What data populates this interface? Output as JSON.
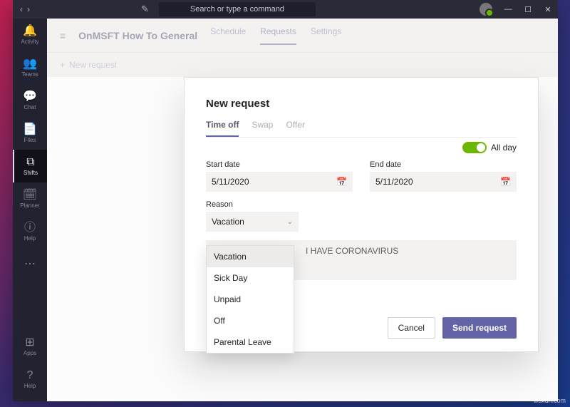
{
  "titlebar": {
    "search_placeholder": "Search or type a command",
    "min": "—",
    "max": "☐",
    "close": "✕",
    "back": "‹",
    "forward": "›",
    "compose_glyph": "✎"
  },
  "sidebar": {
    "items": [
      {
        "glyph": "🔔",
        "label": "Activity"
      },
      {
        "glyph": "👥",
        "label": "Teams"
      },
      {
        "glyph": "💬",
        "label": "Chat"
      },
      {
        "glyph": "📄",
        "label": "Files"
      },
      {
        "glyph": "⧉",
        "label": "Shifts"
      },
      {
        "glyph": "🗓",
        "label": "Planner"
      },
      {
        "glyph": "ⓘ",
        "label": "Help"
      },
      {
        "glyph": "⋯",
        "label": ""
      }
    ],
    "apps": {
      "glyph": "⊞",
      "label": "Apps"
    },
    "help": {
      "glyph": "?",
      "label": "Help"
    }
  },
  "header": {
    "hamburger": "≡",
    "team_title": "OnMSFT How To General",
    "tabs": {
      "schedule": "Schedule",
      "requests": "Requests",
      "settings": "Settings"
    }
  },
  "subbar": {
    "new_plus": "+",
    "new_label": "New request"
  },
  "modal": {
    "title": "New request",
    "tabs": {
      "timeoff": "Time off",
      "swap": "Swap",
      "offer": "Offer"
    },
    "allday_label": "All day",
    "start_label": "Start date",
    "end_label": "End date",
    "start_value": "5/11/2020",
    "end_value": "5/11/2020",
    "reason_label": "Reason",
    "reason_value": "Vacation",
    "reason_options": [
      "Vacation",
      "Sick Day",
      "Unpaid",
      "Off",
      "Parental Leave"
    ],
    "note_placeholder": "I HAVE CORONAVIRUS",
    "cancel": "Cancel",
    "send": "Send request",
    "cal_glyph": "📅",
    "chev_glyph": "⌄"
  },
  "watermark": "wsxdn.com"
}
